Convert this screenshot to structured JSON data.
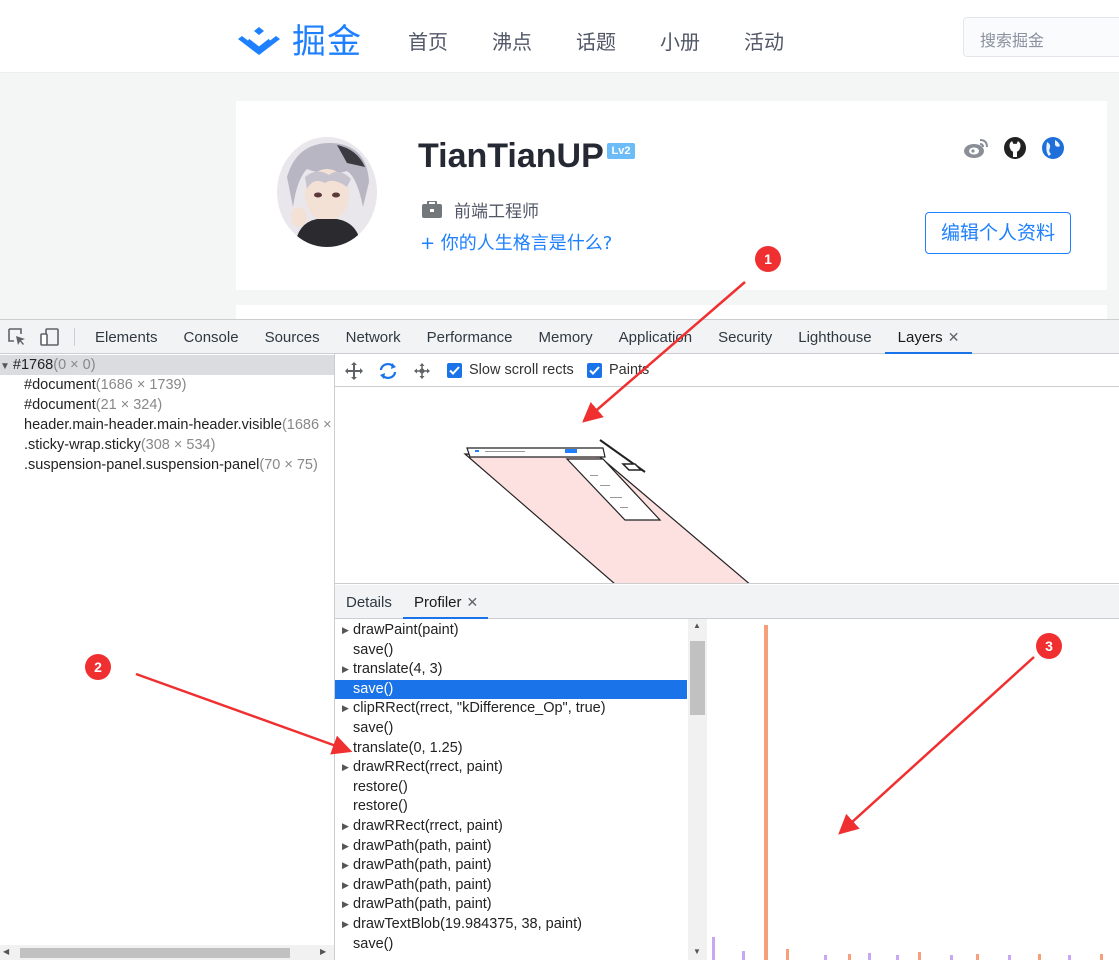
{
  "site": {
    "logo_text": "掘金",
    "nav": [
      "首页",
      "沸点",
      "话题",
      "小册",
      "活动"
    ],
    "search_placeholder": "搜索掘金"
  },
  "profile": {
    "username": "TianTianUP",
    "level_badge": "Lv2",
    "job_title": "前端工程师",
    "motto": "+ 你的人生格言是什么?",
    "edit_button": "编辑个人资料",
    "social_icons": [
      "weibo-icon",
      "github-icon",
      "globe-icon"
    ]
  },
  "devtools": {
    "tabs": [
      {
        "label": "Elements"
      },
      {
        "label": "Console"
      },
      {
        "label": "Sources"
      },
      {
        "label": "Network"
      },
      {
        "label": "Performance"
      },
      {
        "label": "Memory"
      },
      {
        "label": "Application"
      },
      {
        "label": "Security"
      },
      {
        "label": "Lighthouse"
      },
      {
        "label": "Layers",
        "active": true
      }
    ],
    "layer_tree": [
      {
        "name": "#1768",
        "size": "(0 × 0)",
        "selected": true,
        "expanded": true
      },
      {
        "name": "#document",
        "size": "(1686 × 1739)"
      },
      {
        "name": "#document",
        "size": "(21 × 324)"
      },
      {
        "name": "header.main-header.main-header.visible",
        "size": "(1686 ×"
      },
      {
        "name": ".sticky-wrap.sticky",
        "size": "(308 × 534)"
      },
      {
        "name": ".suspension-panel.suspension-panel",
        "size": "(70 × 75)"
      }
    ],
    "layers_toolbar": {
      "tools": [
        "pan-icon",
        "rotate-icon",
        "reset-transform-icon"
      ],
      "slow_scroll_rects": {
        "label": "Slow scroll rects",
        "checked": true
      },
      "paints": {
        "label": "Paints",
        "checked": true
      }
    },
    "bottom_tabs": [
      {
        "label": "Details"
      },
      {
        "label": "Profiler",
        "active": true
      }
    ],
    "profiler_commands": [
      {
        "text": "drawPaint(paint)",
        "expandable": true
      },
      {
        "text": "save()"
      },
      {
        "text": "translate(4, 3)",
        "expandable": true
      },
      {
        "text": "save()",
        "selected": true
      },
      {
        "text": "clipRRect(rrect, \"kDifference_Op\", true)",
        "expandable": true
      },
      {
        "text": "save()"
      },
      {
        "text": "translate(0, 1.25)"
      },
      {
        "text": "drawRRect(rrect, paint)",
        "expandable": true
      },
      {
        "text": "restore()"
      },
      {
        "text": "restore()"
      },
      {
        "text": "drawRRect(rrect, paint)",
        "expandable": true
      },
      {
        "text": "drawPath(path, paint)",
        "expandable": true
      },
      {
        "text": "drawPath(path, paint)",
        "expandable": true
      },
      {
        "text": "drawPath(path, paint)",
        "expandable": true
      },
      {
        "text": "drawPath(path, paint)",
        "expandable": true
      },
      {
        "text": "drawTextBlob(19.984375, 38, paint)",
        "expandable": true
      },
      {
        "text": "save()"
      }
    ]
  },
  "annotations": [
    "1",
    "2",
    "3"
  ],
  "colors": {
    "brand": "#1e80ff",
    "devtools_accent": "#1a73e8",
    "annotation_red": "#f03030",
    "layer_fill": "#fde0e0",
    "timeline_orange": "#f6a07b",
    "timeline_purple": "#c9a7f5"
  }
}
